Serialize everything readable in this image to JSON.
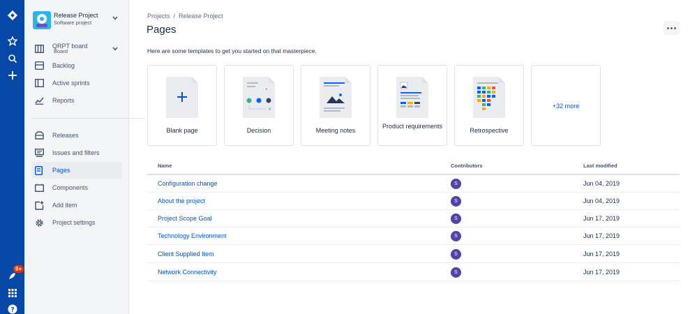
{
  "project": {
    "name": "Release Project",
    "type": "Software project"
  },
  "sidebar": {
    "board": {
      "label": "QRPT board",
      "sub": "Board"
    },
    "items": [
      {
        "label": "Backlog",
        "icon": "backlog-icon"
      },
      {
        "label": "Active sprints",
        "icon": "active-sprints-icon"
      },
      {
        "label": "Reports",
        "icon": "reports-icon"
      },
      {
        "label": "Releases",
        "icon": "releases-icon"
      },
      {
        "label": "Issues and filters",
        "icon": "issues-icon"
      },
      {
        "label": "Pages",
        "icon": "pages-icon",
        "active": true
      },
      {
        "label": "Components",
        "icon": "components-icon"
      },
      {
        "label": "Add item",
        "icon": "add-item-icon"
      },
      {
        "label": "Project settings",
        "icon": "gear-icon"
      }
    ]
  },
  "global_nav": {
    "notification_badge": "9+"
  },
  "breadcrumb": [
    "Projects",
    "Release Project"
  ],
  "page_title": "Pages",
  "intro_text": "Here are some templates to get you started on that masterpiece.",
  "templates": [
    {
      "label": "Blank page"
    },
    {
      "label": "Decision"
    },
    {
      "label": "Meeting notes"
    },
    {
      "label": "Product requirements"
    },
    {
      "label": "Retrospective"
    }
  ],
  "more_templates": "+32 more",
  "table": {
    "columns": [
      "Name",
      "Contributors",
      "Last modified"
    ],
    "rows": [
      {
        "name": "Configuration change",
        "contributor": "S",
        "modified": "Jun 04, 2019"
      },
      {
        "name": "About the project",
        "contributor": "S",
        "modified": "Jun 04, 2019"
      },
      {
        "name": "Project Scope Goal",
        "contributor": "S",
        "modified": "Jun 17, 2019"
      },
      {
        "name": "Technology Environment",
        "contributor": "S",
        "modified": "Jun 17, 2019"
      },
      {
        "name": "Client Supplied Item",
        "contributor": "S",
        "modified": "Jun 17, 2019"
      },
      {
        "name": "Network Connectivity",
        "contributor": "S",
        "modified": "Jun 17, 2019"
      }
    ]
  },
  "colors": {
    "global_nav": "#0747a6",
    "link": "#0052cc",
    "avatar": "#5243aa"
  }
}
